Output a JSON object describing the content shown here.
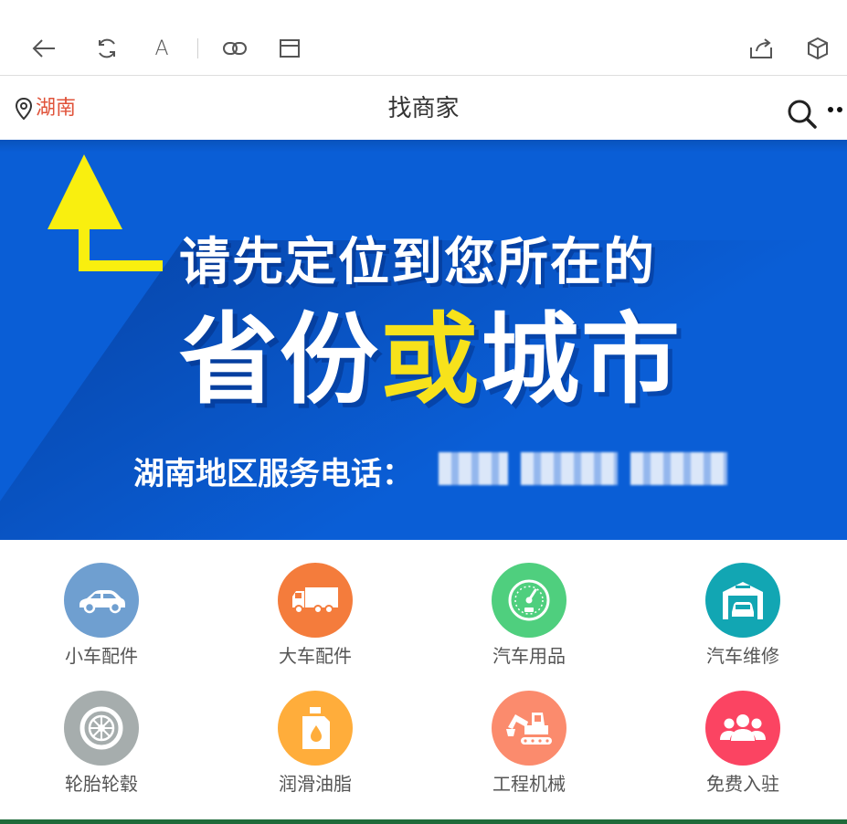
{
  "browser": {
    "font_button_label": "A"
  },
  "header": {
    "location": "湖南",
    "title": "找商家"
  },
  "banner": {
    "line1": "请先定位到您所在的",
    "line2_part1": "省份",
    "line2_highlight": "或",
    "line2_part2": "城市",
    "phone_label": "湖南地区服务电话：",
    "highlight_color": "#f7e21b",
    "background_color": "#0a5ed6"
  },
  "categories": [
    {
      "label": "小车配件",
      "icon": "car-icon",
      "color": "#6f9fd0"
    },
    {
      "label": "大车配件",
      "icon": "truck-icon",
      "color": "#f47c3c"
    },
    {
      "label": "汽车用品",
      "icon": "gauge-icon",
      "color": "#4fcf7e"
    },
    {
      "label": "汽车维修",
      "icon": "garage-icon",
      "color": "#12a6b3"
    },
    {
      "label": "轮胎轮毂",
      "icon": "tire-icon",
      "color": "#a6adad"
    },
    {
      "label": "润滑油脂",
      "icon": "oil-can-icon",
      "color": "#ffad3b"
    },
    {
      "label": "工程机械",
      "icon": "excavator-icon",
      "color": "#fb8b6d"
    },
    {
      "label": "免费入驻",
      "icon": "people-icon",
      "color": "#fb4462"
    }
  ]
}
